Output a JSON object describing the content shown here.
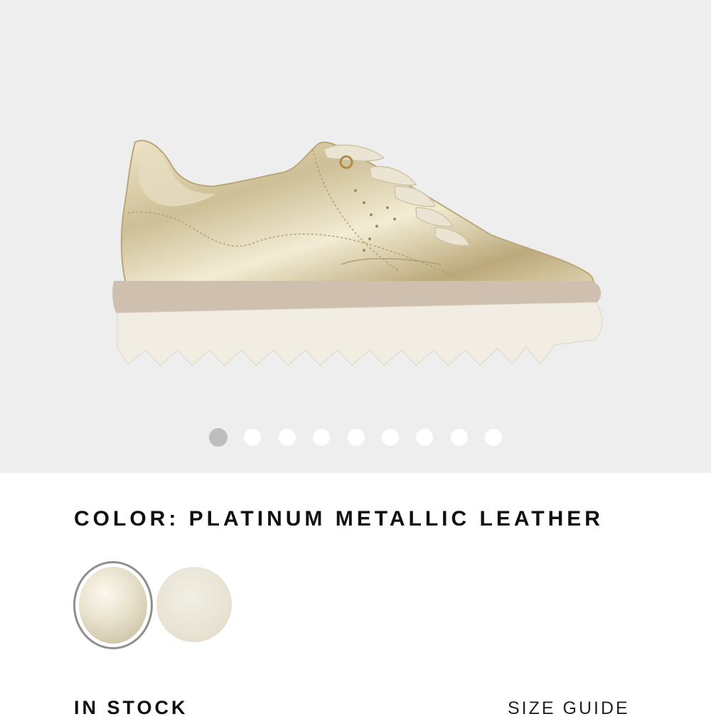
{
  "product": {
    "color_label": "COLOR: PLATINUM METALLIC LEATHER",
    "image_name": "platinum-metallic-leather-sneaker"
  },
  "gallery": {
    "image_count": 9,
    "active_index": 0
  },
  "swatches": [
    {
      "name": "Platinum Metallic Leather",
      "selected": true,
      "color": "#e6dfc8"
    },
    {
      "name": "Off-white",
      "selected": false,
      "color": "#e9e5d7"
    }
  ],
  "availability": {
    "stock_label": "IN STOCK",
    "size_guide_label": "SIZE GUIDE"
  },
  "colors": {
    "gallery_background": "#eeeeee",
    "active_dot": "#bdbdbd",
    "inactive_dot": "#ffffff",
    "text": "#111111"
  }
}
